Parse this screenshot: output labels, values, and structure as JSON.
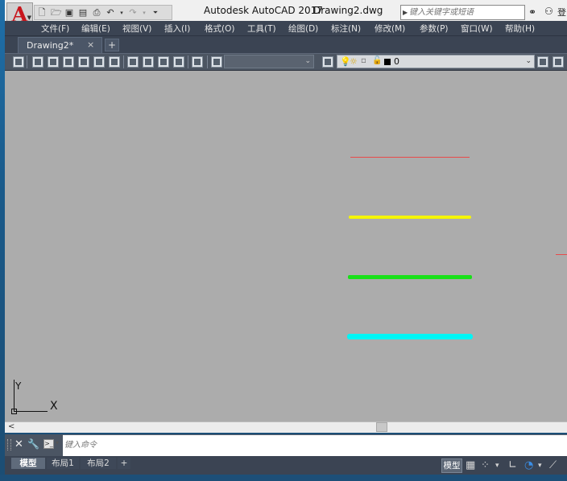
{
  "app": {
    "title": "Autodesk AutoCAD 2017",
    "document": "Drawing2.dwg",
    "logo_letter": "A"
  },
  "search": {
    "placeholder": "键入关键字或短语"
  },
  "header_right": {
    "login_label": "登"
  },
  "menubar": {
    "items": [
      "文件(F)",
      "编辑(E)",
      "视图(V)",
      "插入(I)",
      "格式(O)",
      "工具(T)",
      "绘图(D)",
      "标注(N)",
      "修改(M)",
      "参数(P)",
      "窗口(W)",
      "帮助(H)"
    ]
  },
  "tabs": {
    "document_tab": "Drawing2*",
    "close_glyph": "×",
    "new_tab_glyph": "+"
  },
  "toolbar": {
    "visual_style_value": "",
    "layer_value": "0"
  },
  "drawing": {
    "lines": [
      {
        "color": "#e84a4a",
        "label": "red-line"
      },
      {
        "color": "#f5f500",
        "label": "yellow-line"
      },
      {
        "color": "#19e019",
        "label": "green-line"
      },
      {
        "color": "#00f5f5",
        "label": "cyan-line"
      }
    ],
    "ucs": {
      "x_label": "X",
      "y_label": "Y"
    }
  },
  "scrollbar": {
    "left_arrow": "<"
  },
  "command": {
    "close_glyph": "✕",
    "wrench_glyph": "🔧",
    "prompt_glyph": ">_",
    "placeholder": "键入命令"
  },
  "layout_tabs": {
    "items": [
      "模型",
      "布局1",
      "布局2"
    ],
    "add_glyph": "+"
  },
  "status": {
    "model_label": "模型"
  }
}
